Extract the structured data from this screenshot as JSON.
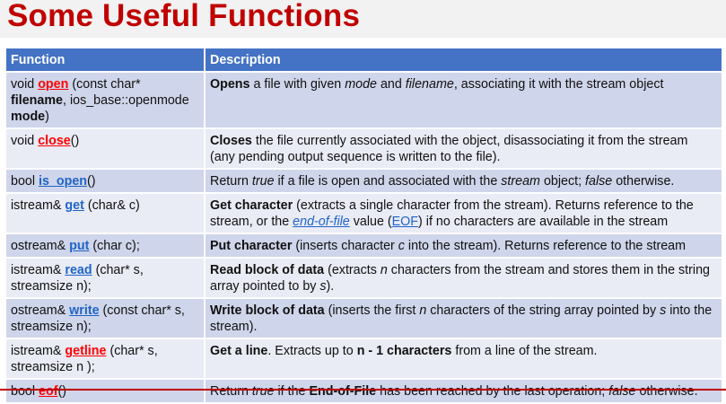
{
  "title": "Some Useful Functions",
  "colors": {
    "title": "#c00000",
    "header": "#4472c4",
    "row_odd": "#cfd5ea",
    "row_even": "#e9ebf5",
    "link_red": "#ff0000",
    "link_blue": "#1f64c8"
  },
  "headers": [
    "Function",
    "Description"
  ],
  "rows": [
    {
      "name": "open",
      "function": [
        [
          "void ",
          ""
        ],
        [
          "open",
          "lr"
        ],
        [
          " (const char* ",
          ""
        ],
        [
          "filename",
          "b"
        ],
        [
          ", ios_base::openmode ",
          ""
        ],
        [
          "mode",
          "b"
        ],
        [
          ")",
          ""
        ]
      ],
      "description": [
        [
          "Opens",
          "b"
        ],
        [
          " a file with given ",
          ""
        ],
        [
          "mode",
          "i"
        ],
        [
          " and ",
          ""
        ],
        [
          "filename",
          "i"
        ],
        [
          ", associating it with the stream object",
          ""
        ]
      ]
    },
    {
      "name": "close",
      "function": [
        [
          "void ",
          ""
        ],
        [
          "close",
          "lr"
        ],
        [
          "()",
          ""
        ]
      ],
      "description": [
        [
          "Closes",
          "b"
        ],
        [
          " the file currently associated with the object, disassociating it from the stream (any pending output sequence is written to the file).",
          ""
        ]
      ]
    },
    {
      "name": "is-open",
      "function": [
        [
          "bool ",
          ""
        ],
        [
          "is_open",
          "lb"
        ],
        [
          "()",
          ""
        ]
      ],
      "description": [
        [
          "Return ",
          ""
        ],
        [
          "true",
          "i"
        ],
        [
          " if a file is open and associated with the ",
          ""
        ],
        [
          "stream",
          "i"
        ],
        [
          " object; ",
          ""
        ],
        [
          "false",
          "i"
        ],
        [
          " otherwise.",
          ""
        ]
      ]
    },
    {
      "name": "get",
      "function": [
        [
          "istream& ",
          ""
        ],
        [
          "get",
          "lb"
        ],
        [
          " (char& c)",
          ""
        ]
      ],
      "description": [
        [
          "Get character",
          "b"
        ],
        [
          " (extracts a single character from the stream). Returns reference to the stream, or the ",
          ""
        ],
        [
          "end-of-file",
          "lki"
        ],
        [
          " value (",
          ""
        ],
        [
          "EOF",
          "lk"
        ],
        [
          ") if no characters are available in the stream",
          ""
        ]
      ]
    },
    {
      "name": "put",
      "function": [
        [
          "ostream& ",
          ""
        ],
        [
          "put",
          "lb"
        ],
        [
          " (char c);",
          ""
        ]
      ],
      "description": [
        [
          "Put character",
          "b"
        ],
        [
          " (inserts character ",
          ""
        ],
        [
          "c",
          "i"
        ],
        [
          " into the stream). Returns reference to the stream",
          ""
        ]
      ]
    },
    {
      "name": "read",
      "function": [
        [
          "istream& ",
          ""
        ],
        [
          "read",
          "lb"
        ],
        [
          " (char* s, streamsize n);",
          ""
        ]
      ],
      "description": [
        [
          "Read block of data",
          "b"
        ],
        [
          " (extracts ",
          ""
        ],
        [
          "n",
          "i"
        ],
        [
          " characters from the stream and stores them in the string array pointed to by ",
          ""
        ],
        [
          "s",
          "i"
        ],
        [
          ").",
          ""
        ]
      ]
    },
    {
      "name": "write",
      "function": [
        [
          "ostream& ",
          ""
        ],
        [
          "write",
          "lb"
        ],
        [
          " (const char* s, streamsize n);",
          ""
        ]
      ],
      "description": [
        [
          "Write block of data",
          "b"
        ],
        [
          " (inserts the first ",
          ""
        ],
        [
          "n",
          "i"
        ],
        [
          " characters of the string array pointed by ",
          ""
        ],
        [
          "s",
          "i"
        ],
        [
          " into the stream).",
          ""
        ]
      ]
    },
    {
      "name": "getline",
      "function": [
        [
          "istream& ",
          ""
        ],
        [
          "getline",
          "lr"
        ],
        [
          " (char* s, streamsize n );",
          ""
        ]
      ],
      "description": [
        [
          "Get a line",
          "b"
        ],
        [
          ". Extracts up to ",
          ""
        ],
        [
          "n - 1 characters",
          "b"
        ],
        [
          "  from a line of the stream.",
          ""
        ]
      ]
    },
    {
      "name": "eof",
      "function": [
        [
          "bool ",
          ""
        ],
        [
          "eof",
          "lr"
        ],
        [
          "()",
          ""
        ]
      ],
      "description": [
        [
          "Return ",
          ""
        ],
        [
          "true",
          "i"
        ],
        [
          " if the ",
          ""
        ],
        [
          "End-of-File",
          "b"
        ],
        [
          " has been reached by the last operation; ",
          ""
        ],
        [
          "false",
          "i"
        ],
        [
          " otherwise.",
          ""
        ]
      ]
    }
  ]
}
